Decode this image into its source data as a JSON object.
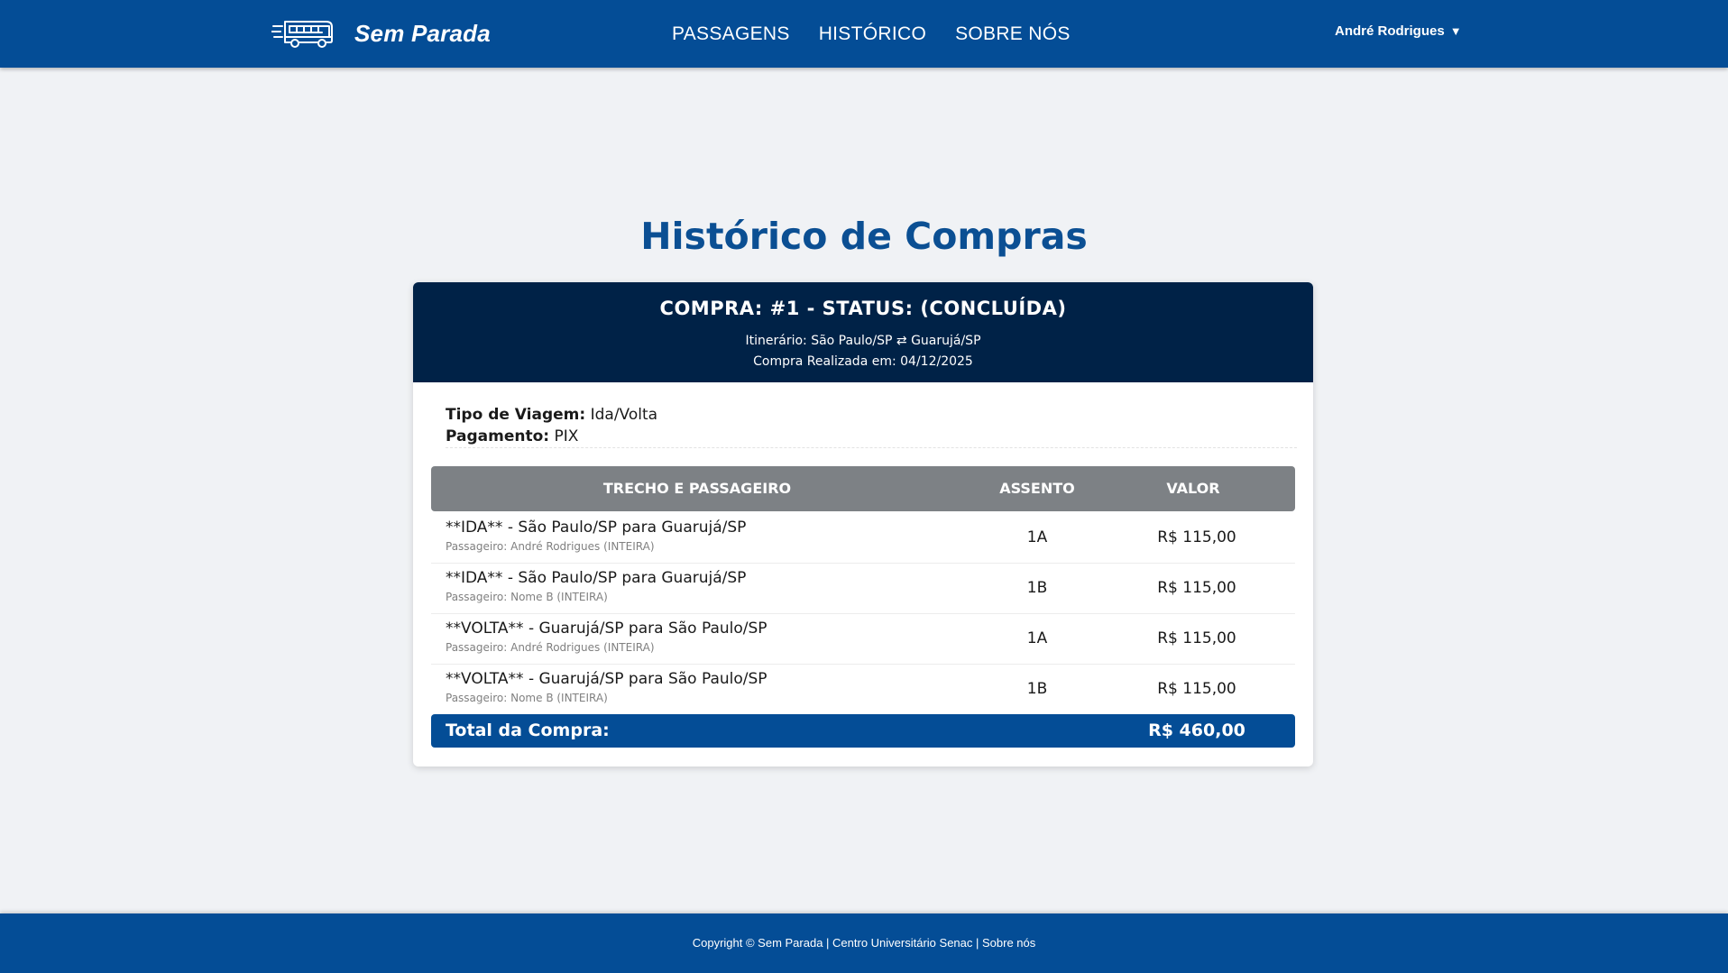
{
  "header": {
    "brand_name": "Sem Parada",
    "brand_icon": "bus-icon",
    "nav": [
      {
        "label": "PASSAGENS"
      },
      {
        "label": "HISTÓRICO"
      },
      {
        "label": "SOBRE NÓS"
      }
    ],
    "user_name": "André Rodrigues",
    "user_caret": "▼"
  },
  "page": {
    "title": "Histórico de Compras"
  },
  "order": {
    "title": "COMPRA: #1 - STATUS: (CONCLUÍDA)",
    "itinerary": "Itinerário: São Paulo/SP ⇄ Guarujá/SP",
    "purchase_date": "Compra Realizada em: 04/12/2025",
    "trip_type_label": "Tipo de Viagem:",
    "trip_type_value": "Ida/Volta",
    "payment_label": "Pagamento:",
    "payment_value": "PIX",
    "columns": {
      "segment": "TRECHO E PASSAGEIRO",
      "seat": "ASSENTO",
      "value": "VALOR"
    },
    "rows": [
      {
        "route": "**IDA** - São Paulo/SP para Guarujá/SP",
        "passenger": "Passageiro: André Rodrigues (INTEIRA)",
        "seat": "1A",
        "price": "R$ 115,00"
      },
      {
        "route": "**IDA** - São Paulo/SP para Guarujá/SP",
        "passenger": "Passageiro: Nome B (INTEIRA)",
        "seat": "1B",
        "price": "R$ 115,00"
      },
      {
        "route": "**VOLTA** - Guarujá/SP para São Paulo/SP",
        "passenger": "Passageiro: André Rodrigues (INTEIRA)",
        "seat": "1A",
        "price": "R$ 115,00"
      },
      {
        "route": "**VOLTA** - Guarujá/SP para São Paulo/SP",
        "passenger": "Passageiro: Nome B (INTEIRA)",
        "seat": "1B",
        "price": "R$ 115,00"
      }
    ],
    "total_label": "Total da Compra:",
    "total_value": "R$ 460,00"
  },
  "footer": {
    "text": "Copyright © Sem Parada | Centro Universitário Senac | Sobre nós"
  },
  "colors": {
    "brand_blue": "#044d96",
    "card_header_navy": "#002247",
    "title_blue": "#0b4f93",
    "table_header_gray": "#7d8185",
    "page_background": "#f0f2f5"
  }
}
